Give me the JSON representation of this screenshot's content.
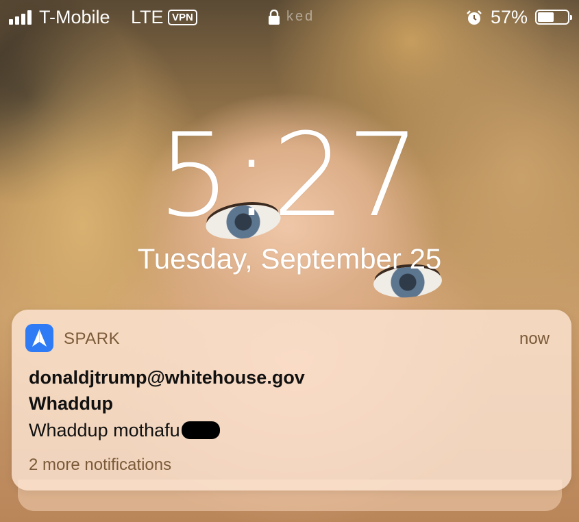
{
  "status_bar": {
    "carrier": "T-Mobile",
    "network": "LTE",
    "vpn": "VPN",
    "locked_text": "ked",
    "battery_percent_label": "57%",
    "battery_level": 0.57
  },
  "lock_screen": {
    "time": "5:27",
    "date": "Tuesday, September 25"
  },
  "notification": {
    "app_name": "SPARK",
    "timestamp": "now",
    "sender": "donaldjtrump@whitehouse.gov",
    "subject": "Whaddup",
    "body": "Whaddup mothafu",
    "more": "2 more notifications",
    "app_icon_color": "#2f7bf5"
  }
}
